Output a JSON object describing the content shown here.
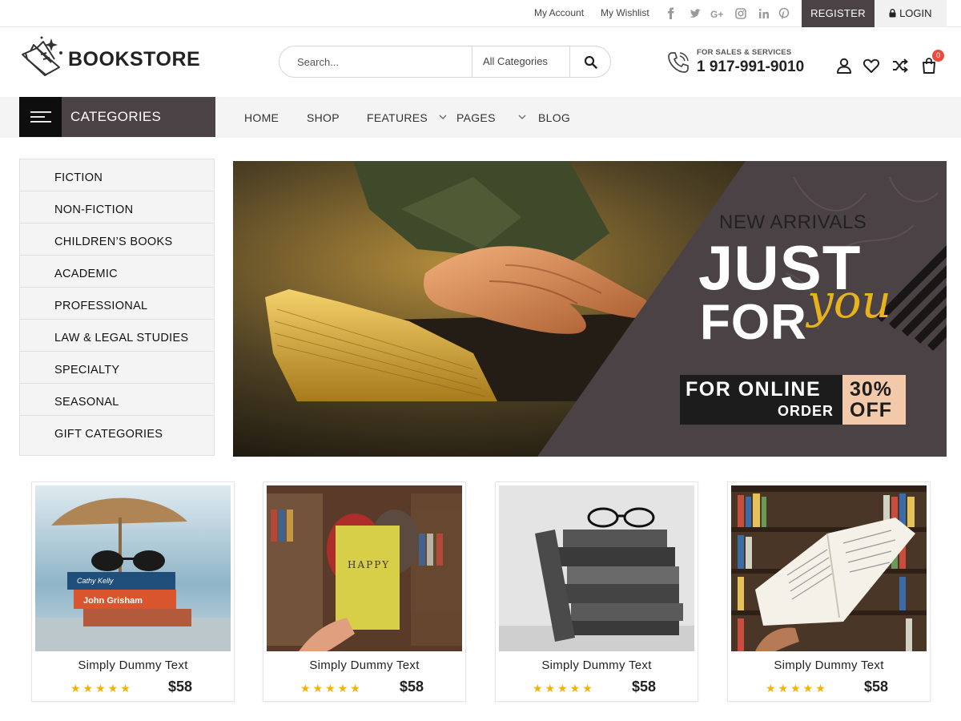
{
  "topbar": {
    "my_account": "My Account",
    "my_wishlist": "My Wishlist",
    "social": [
      "facebook-icon",
      "twitter-icon",
      "google-plus-icon",
      "instagram-icon",
      "linkedin-icon",
      "pinterest-icon"
    ],
    "register": "REGISTER",
    "login": "LOGIN"
  },
  "header": {
    "logo": "BOOKSTORE",
    "search_placeholder": "Search...",
    "search_category": "All Categories",
    "sales_label": "FOR SALES & SERVICES",
    "sales_phone": "1 917-991-9010",
    "cart_count": "0"
  },
  "nav": {
    "categories_label": "CATEGORIES",
    "items": [
      "HOME",
      "SHOP",
      "FEATURES",
      "PAGES",
      "BLOG"
    ]
  },
  "sidebar": {
    "items": [
      "FICTION",
      "NON-FICTION",
      "CHILDREN’S BOOKS",
      "ACADEMIC",
      "PROFESSIONAL",
      "LAW & LEGAL STUDIES",
      "SPECIALTY",
      "SEASONAL",
      "GIFT CATEGORIES"
    ]
  },
  "banner": {
    "new_arrivals": "NEW ARRIVALS",
    "just": "JUST",
    "for": "FOR",
    "you": "you",
    "promo_line1": "FOR ONLINE",
    "promo_line2": "ORDER",
    "discount_line1": "30%",
    "discount_line2": "OFF"
  },
  "products": [
    {
      "title": "Simply Dummy Text",
      "price": "$58",
      "rating": 5
    },
    {
      "title": "Simply Dummy Text",
      "price": "$58",
      "rating": 5
    },
    {
      "title": "Simply Dummy Text",
      "price": "$58",
      "rating": 5
    },
    {
      "title": "Simply Dummy Text",
      "price": "$58",
      "rating": 5
    }
  ],
  "colors": {
    "accent_dark": "#4a4244",
    "badge": "#e74c3c",
    "star": "#f5b301",
    "script": "#e8b21c",
    "discount_bg": "#f2c9a9"
  }
}
